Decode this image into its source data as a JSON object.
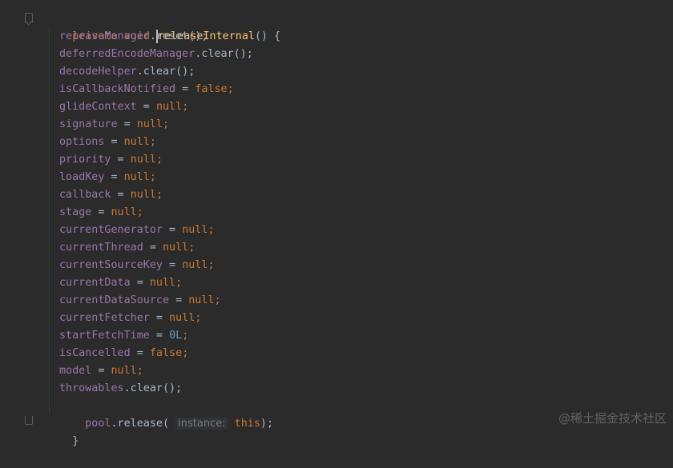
{
  "code": {
    "signature": {
      "modifier": "private",
      "return_type": "void",
      "method_name": "releaseInternal",
      "tail": "() {"
    },
    "statements": [
      {
        "target": "releaseManager",
        "rest": ".reset();"
      },
      {
        "target": "deferredEncodeManager",
        "rest": ".clear();"
      },
      {
        "target": "decodeHelper",
        "rest": ".clear();"
      },
      {
        "target": "isCallbackNotified",
        "op": " = ",
        "value": "false",
        "value_kind": "kw",
        "end": ";"
      },
      {
        "target": "glideContext",
        "op": " = ",
        "value": "null",
        "value_kind": "kw",
        "end": ";"
      },
      {
        "target": "signature",
        "op": " = ",
        "value": "null",
        "value_kind": "kw",
        "end": ";"
      },
      {
        "target": "options",
        "op": " = ",
        "value": "null",
        "value_kind": "kw",
        "end": ";"
      },
      {
        "target": "priority",
        "op": " = ",
        "value": "null",
        "value_kind": "kw",
        "end": ";"
      },
      {
        "target": "loadKey",
        "op": " = ",
        "value": "null",
        "value_kind": "kw",
        "end": ";"
      },
      {
        "target": "callback",
        "op": " = ",
        "value": "null",
        "value_kind": "kw",
        "end": ";"
      },
      {
        "target": "stage",
        "op": " = ",
        "value": "null",
        "value_kind": "kw",
        "end": ";"
      },
      {
        "target": "currentGenerator",
        "op": " = ",
        "value": "null",
        "value_kind": "kw",
        "end": ";"
      },
      {
        "target": "currentThread",
        "op": " = ",
        "value": "null",
        "value_kind": "kw",
        "end": ";"
      },
      {
        "target": "currentSourceKey",
        "op": " = ",
        "value": "null",
        "value_kind": "kw",
        "end": ";"
      },
      {
        "target": "currentData",
        "op": " = ",
        "value": "null",
        "value_kind": "kw",
        "end": ";"
      },
      {
        "target": "currentDataSource",
        "op": " = ",
        "value": "null",
        "value_kind": "kw",
        "end": ";"
      },
      {
        "target": "currentFetcher",
        "op": " = ",
        "value": "null",
        "value_kind": "kw",
        "end": ";"
      },
      {
        "target": "startFetchTime",
        "op": " = ",
        "value": "0L",
        "value_kind": "num",
        "end": ";"
      },
      {
        "target": "isCancelled",
        "op": " = ",
        "value": "false",
        "value_kind": "kw",
        "end": ";"
      },
      {
        "target": "model",
        "op": " = ",
        "value": "null",
        "value_kind": "kw",
        "end": ";"
      },
      {
        "target": "throwables",
        "rest": ".clear();"
      }
    ],
    "pool_line": {
      "target": "pool",
      "call": ".release(",
      "param_hint": "instance:",
      "arg": "this",
      "end": ");"
    },
    "closing_brace": "}"
  },
  "watermark": "@稀土掘金技术社区",
  "colors": {
    "background": "#2b2b2b",
    "text": "#a9b7c6",
    "keyword": "#cc7832",
    "method": "#ffc66d",
    "field": "#9876aa",
    "number": "#6897bb",
    "hint": "#787878"
  }
}
